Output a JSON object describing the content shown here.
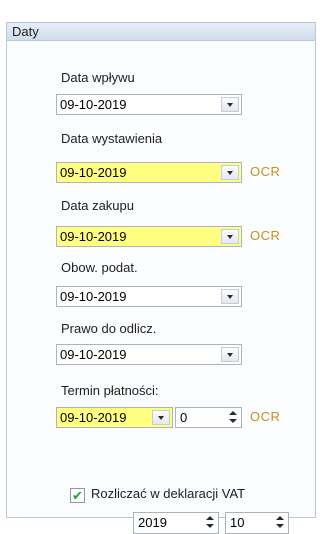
{
  "section_title": "Daty",
  "fields": [
    {
      "label": "Data wpływu",
      "value": "09-10-2019",
      "highlighted": false,
      "ocr": ""
    },
    {
      "label": "Data wystawienia",
      "value": "09-10-2019",
      "highlighted": true,
      "ocr": "OCR"
    },
    {
      "label": "Data zakupu",
      "value": "09-10-2019",
      "highlighted": true,
      "ocr": "OCR"
    },
    {
      "label": "Obow. podat.",
      "value": "09-10-2019",
      "highlighted": false,
      "ocr": ""
    },
    {
      "label": "Prawo do odlicz.",
      "value": "09-10-2019",
      "highlighted": false,
      "ocr": ""
    }
  ],
  "termin": {
    "label": "Termin płatności:",
    "date_value": "09-10-2019",
    "days_value": "0",
    "ocr": "OCR"
  },
  "vat": {
    "checkbox_label": "Rozliczać w deklaracji VAT",
    "checked": true,
    "year": "2019",
    "month": "10"
  },
  "colors": {
    "highlight": "#ffff80",
    "ocr_text": "#c7901b",
    "check": "#1f9e3a"
  }
}
